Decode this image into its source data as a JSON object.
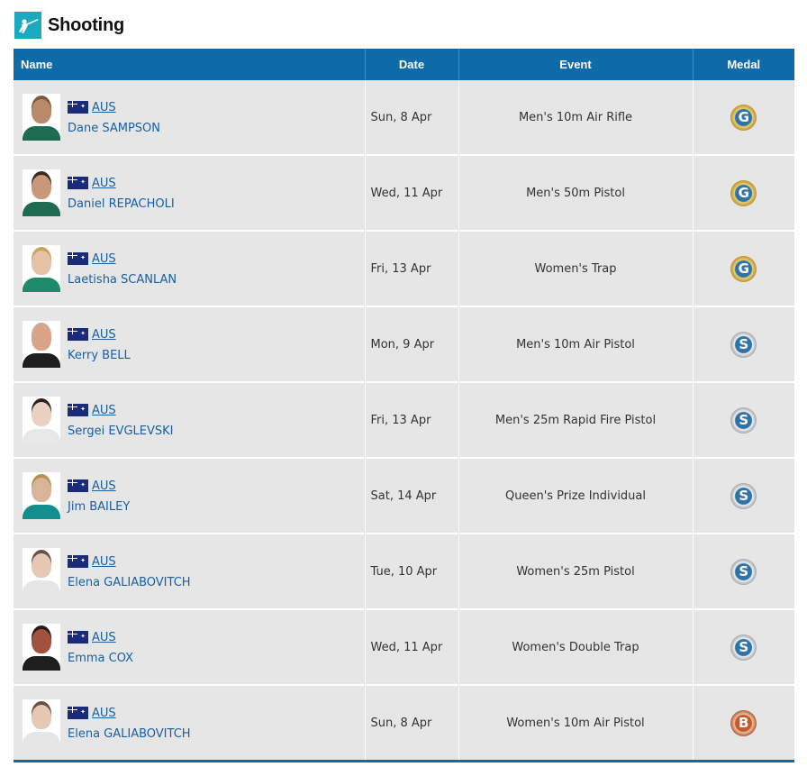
{
  "header": {
    "title": "Shooting",
    "icon": "shooting-sport-icon"
  },
  "columns": {
    "name": "Name",
    "date": "Date",
    "event": "Event",
    "medal": "Medal"
  },
  "rows": [
    {
      "country": "AUS",
      "name": "Dane SAMPSON",
      "date": "Sun, 8 Apr",
      "event": "Men's 10m Air Rifle",
      "medal": "G",
      "medal_type": "gold"
    },
    {
      "country": "AUS",
      "name": "Daniel REPACHOLI",
      "date": "Wed, 11 Apr",
      "event": "Men's 50m Pistol",
      "medal": "G",
      "medal_type": "gold"
    },
    {
      "country": "AUS",
      "name": "Laetisha SCANLAN",
      "date": "Fri, 13 Apr",
      "event": "Women's Trap",
      "medal": "G",
      "medal_type": "gold"
    },
    {
      "country": "AUS",
      "name": "Kerry BELL",
      "date": "Mon, 9 Apr",
      "event": "Men's 10m Air Pistol",
      "medal": "S",
      "medal_type": "silver"
    },
    {
      "country": "AUS",
      "name": "Sergei EVGLEVSKI",
      "date": "Fri, 13 Apr",
      "event": "Men's 25m Rapid Fire Pistol",
      "medal": "S",
      "medal_type": "silver"
    },
    {
      "country": "AUS",
      "name": "Jim BAILEY",
      "date": "Sat, 14 Apr",
      "event": "Queen's Prize Individual",
      "medal": "S",
      "medal_type": "silver"
    },
    {
      "country": "AUS",
      "name": "Elena GALIABOVITCH",
      "date": "Tue, 10 Apr",
      "event": "Women's 25m Pistol",
      "medal": "S",
      "medal_type": "silver"
    },
    {
      "country": "AUS",
      "name": "Emma COX",
      "date": "Wed, 11 Apr",
      "event": "Women's Double Trap",
      "medal": "S",
      "medal_type": "silver"
    },
    {
      "country": "AUS",
      "name": "Elena GALIABOVITCH",
      "date": "Sun, 8 Apr",
      "event": "Women's 10m Air Pistol",
      "medal": "B",
      "medal_type": "bronze"
    }
  ],
  "colors": {
    "header_bg": "#0f6aa8",
    "row_bg": "#e6e6e6",
    "link": "#1a5fa0",
    "icon_bg": "#1aa9bd"
  }
}
